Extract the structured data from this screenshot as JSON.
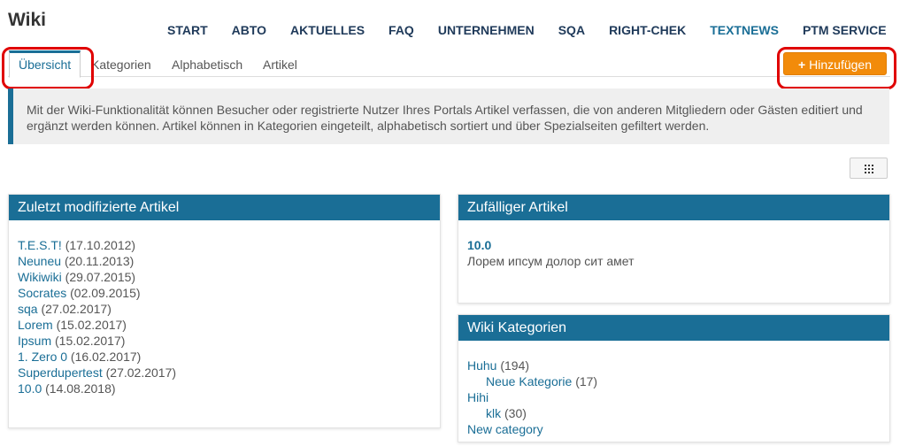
{
  "app": {
    "title": "Wiki"
  },
  "nav": [
    "START",
    "ABTO",
    "AKTUELLES",
    "FAQ",
    "UNTERNEHMEN",
    "SQA",
    "RIGHT-CHEK",
    "TEXTNEWS",
    "PTM SERVICE"
  ],
  "tabs": [
    "Übersicht",
    "Kategorien",
    "Alphabetisch",
    "Artikel"
  ],
  "add_button": {
    "icon": "plus-icon",
    "label": "Hinzufügen"
  },
  "info": "Mit der Wiki-Funktionalität können Besucher oder registrierte Nutzer Ihres Portals Artikel verfassen, die von anderen Mitgliedern oder Gästen editiert und ergänzt werden können. Artikel können in Kategorien eingeteilt, alphabetisch sortiert und über Spezialseiten gefiltert werden.",
  "view_toggle": {
    "icon": "grid-icon"
  },
  "recent": {
    "title": "Zuletzt modifizierte Artikel",
    "items": [
      {
        "name": "T.E.S.T!",
        "date": "(17.10.2012)"
      },
      {
        "name": "Neuneu",
        "date": "(20.11.2013)"
      },
      {
        "name": "Wikiwiki",
        "date": "(29.07.2015)"
      },
      {
        "name": "Socrates",
        "date": "(02.09.2015)"
      },
      {
        "name": "sqa",
        "date": "(27.02.2017)"
      },
      {
        "name": "Lorem",
        "date": "(15.02.2017)"
      },
      {
        "name": "Ipsum",
        "date": "(15.02.2017)"
      },
      {
        "name": "1. Zero 0",
        "date": "(16.02.2017)"
      },
      {
        "name": "Superdupertest",
        "date": "(27.02.2017)"
      },
      {
        "name": "10.0",
        "date": "(14.08.2018)"
      }
    ]
  },
  "random": {
    "title": "Zufälliger Artikel",
    "article_title": "10.0",
    "article_text": "Лорем ипсум долор сит амет"
  },
  "categories": {
    "title": "Wiki Kategorien",
    "items": [
      {
        "name": "Huhu",
        "count": "(194)"
      },
      {
        "name": "Neue Kategorie",
        "count": "(17)"
      },
      {
        "name": "Hihi",
        "count": ""
      },
      {
        "name": "klk",
        "count": "(30)"
      },
      {
        "name": "New category",
        "count": ""
      }
    ]
  },
  "colors": {
    "accent": "#1a6e96",
    "button": "#f28b0a",
    "highlight": "#e00000"
  }
}
